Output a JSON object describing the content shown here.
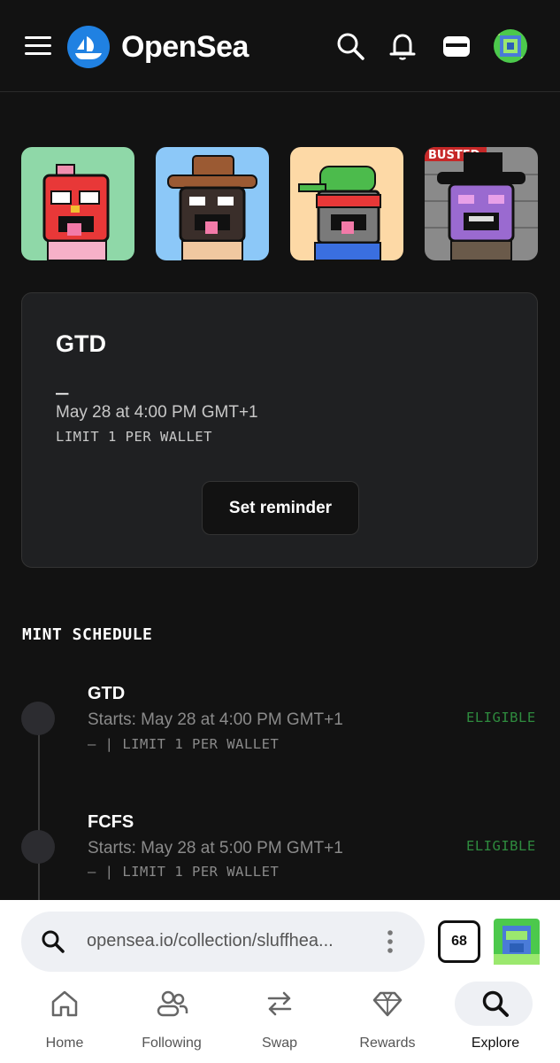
{
  "header": {
    "brand": "OpenSea",
    "icons": [
      "menu-icon",
      "opensea-logo-icon",
      "search-icon",
      "bell-icon",
      "wallet-icon",
      "profile-avatar"
    ]
  },
  "thumbnails": [
    {
      "name": "red-bird-nft",
      "bg": "#8fd8a8"
    },
    {
      "name": "cowboy-bird-nft",
      "bg": "#8cc8f8"
    },
    {
      "name": "green-cap-bird-nft",
      "bg": "#fdd9a6"
    },
    {
      "name": "busted-purple-nft",
      "bg": "#8a8a8a",
      "badge": "BUSTED"
    }
  ],
  "stage_card": {
    "title": "GTD",
    "price": "–",
    "date": "May 28 at 4:00 PM GMT+1",
    "limit": "LIMIT 1 PER WALLET",
    "button": "Set reminder"
  },
  "schedule": {
    "heading": "MINT SCHEDULE",
    "items": [
      {
        "title": "GTD",
        "start": "Starts: May 28 at 4:00 PM GMT+1",
        "limit": "– | LIMIT 1 PER WALLET",
        "status": "ELIGIBLE"
      },
      {
        "title": "FCFS",
        "start": "Starts: May 28 at 5:00 PM GMT+1",
        "limit": "– | LIMIT 1 PER WALLET",
        "status": "ELIGIBLE"
      }
    ]
  },
  "browser": {
    "url": "opensea.io/collection/sluffhea...",
    "tab_count": "68"
  },
  "nav": [
    {
      "label": "Home",
      "icon": "home-icon"
    },
    {
      "label": "Following",
      "icon": "people-icon"
    },
    {
      "label": "Swap",
      "icon": "swap-icon"
    },
    {
      "label": "Rewards",
      "icon": "diamond-icon"
    },
    {
      "label": "Explore",
      "icon": "search-icon",
      "active": true
    }
  ],
  "colors": {
    "accent": "#2081e2",
    "eligible": "#2e8b3e",
    "background": "#121212",
    "card": "#1f2022"
  }
}
